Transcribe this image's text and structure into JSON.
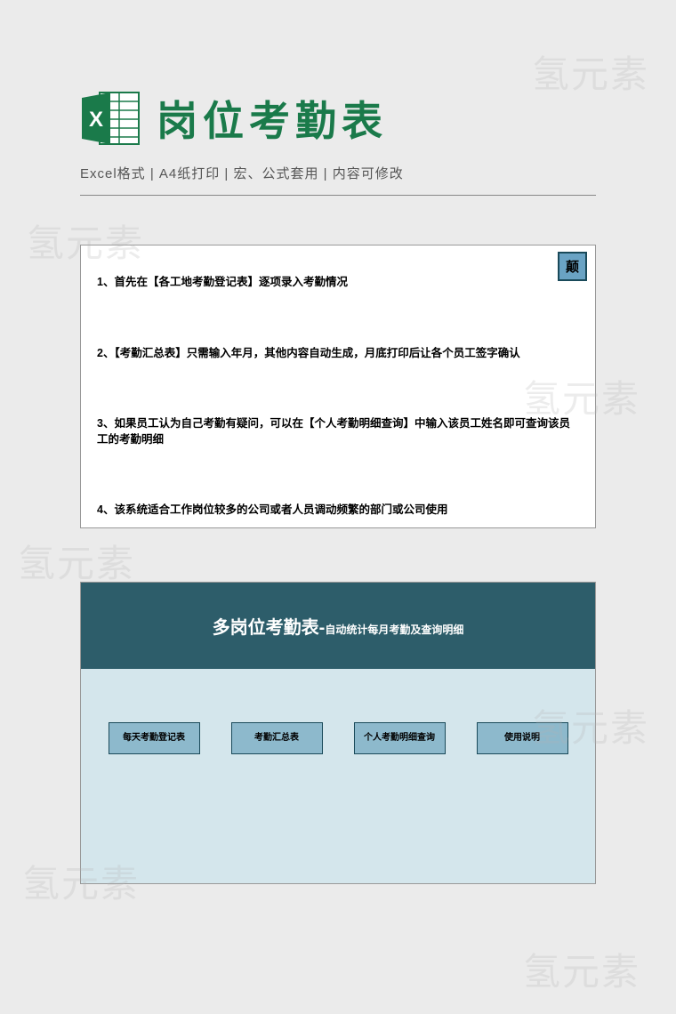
{
  "watermark": "氢元素",
  "header": {
    "title": "岗位考勤表",
    "subtitle": "Excel格式 |  A4纸打印 | 宏、公式套用 | 内容可修改"
  },
  "panel1": {
    "badge": "颠",
    "instructions": [
      "1、首先在【各工地考勤登记表】逐项录入考勤情况",
      "2、【考勤汇总表】只需输入年月，其他内容自动生成，月底打印后让各个员工签字确认",
      "3、如果员工认为自己考勤有疑问，可以在【个人考勤明细查询】中输入该员工姓名即可查询该员工的考勤明细",
      "4、该系统适合工作岗位较多的公司或者人员调动频繁的部门或公司使用"
    ]
  },
  "panel2": {
    "title": "多岗位考勤表-",
    "subtitle": "自动统计每月考勤及查询明细",
    "buttons": [
      "每天考勤登记表",
      "考勤汇总表",
      "个人考勤明细查询",
      "使用说明"
    ]
  }
}
